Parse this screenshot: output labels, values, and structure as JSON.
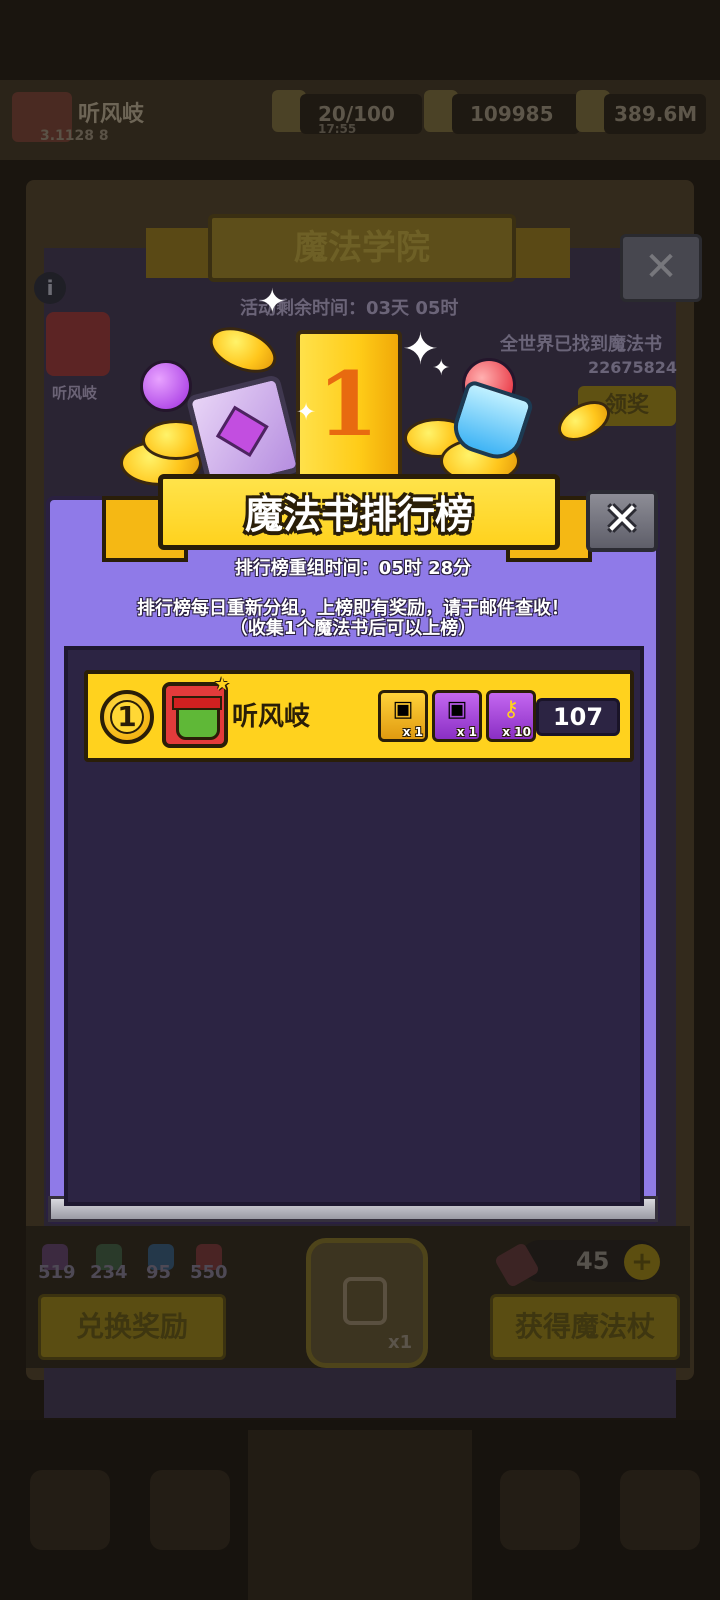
{
  "background": {
    "player_name": "听风岐",
    "player_sub": "3.1128 8",
    "resources": [
      "20/100",
      "109985",
      "389.6M"
    ],
    "resource_timer": "17:55",
    "event_title": "魔法学院",
    "event_timer": "活动剩余时间：03天 05时",
    "found_label": "全世界已找到魔法书",
    "found_count": "22675824",
    "claim_label": "领奖",
    "collected_stats": [
      "519",
      "234",
      "95",
      "550"
    ],
    "exchange_button": "兑换奖励",
    "get_wand_button": "获得魔法杖",
    "lock_multiplier": "x1",
    "wand_count": "45",
    "plus_symbol": "+",
    "close_symbol": "✕",
    "info_symbol": "i"
  },
  "dialog": {
    "title": "魔法书排行榜",
    "close_symbol": "✕",
    "reset_time": "排行榜重组时间：05时 28分",
    "description_line1": "排行榜每日重新分组，上榜即有奖励，请于邮件查收！",
    "description_line2": "（收集1个魔法书后可以上榜）",
    "decoration_rank": "1"
  },
  "leaderboard": {
    "rows": [
      {
        "rank": "1",
        "name": "听风岐",
        "rewards": [
          {
            "icon": "golden-chest-icon",
            "qty": "x 1"
          },
          {
            "icon": "purple-chest-icon",
            "qty": "x 1"
          },
          {
            "icon": "golden-key-icon",
            "qty": "x 10"
          }
        ],
        "score": "107"
      }
    ]
  },
  "colors": {
    "panel": "#8f7ae8",
    "list_bg": "#2c2443",
    "row_gold": "#ffd21e",
    "outline": "#2a1e08"
  }
}
